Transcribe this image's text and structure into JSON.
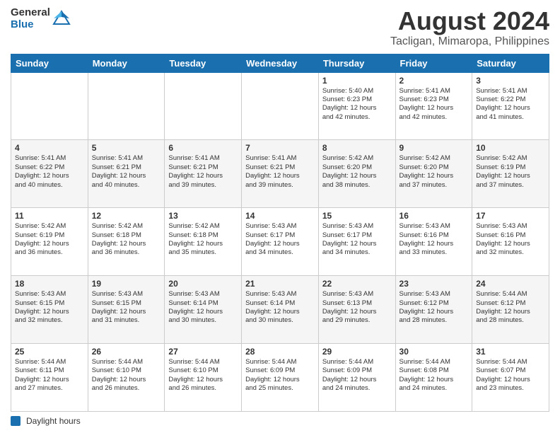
{
  "header": {
    "logo": {
      "line1": "General",
      "line2": "Blue"
    },
    "title": "August 2024",
    "subtitle": "Tacligan, Mimaropa, Philippines"
  },
  "days": [
    "Sunday",
    "Monday",
    "Tuesday",
    "Wednesday",
    "Thursday",
    "Friday",
    "Saturday"
  ],
  "weeks": [
    [
      {
        "day": "",
        "content": ""
      },
      {
        "day": "",
        "content": ""
      },
      {
        "day": "",
        "content": ""
      },
      {
        "day": "",
        "content": ""
      },
      {
        "day": "1",
        "content": "Sunrise: 5:40 AM\nSunset: 6:23 PM\nDaylight: 12 hours\nand 42 minutes."
      },
      {
        "day": "2",
        "content": "Sunrise: 5:41 AM\nSunset: 6:23 PM\nDaylight: 12 hours\nand 42 minutes."
      },
      {
        "day": "3",
        "content": "Sunrise: 5:41 AM\nSunset: 6:22 PM\nDaylight: 12 hours\nand 41 minutes."
      }
    ],
    [
      {
        "day": "4",
        "content": "Sunrise: 5:41 AM\nSunset: 6:22 PM\nDaylight: 12 hours\nand 40 minutes."
      },
      {
        "day": "5",
        "content": "Sunrise: 5:41 AM\nSunset: 6:21 PM\nDaylight: 12 hours\nand 40 minutes."
      },
      {
        "day": "6",
        "content": "Sunrise: 5:41 AM\nSunset: 6:21 PM\nDaylight: 12 hours\nand 39 minutes."
      },
      {
        "day": "7",
        "content": "Sunrise: 5:41 AM\nSunset: 6:21 PM\nDaylight: 12 hours\nand 39 minutes."
      },
      {
        "day": "8",
        "content": "Sunrise: 5:42 AM\nSunset: 6:20 PM\nDaylight: 12 hours\nand 38 minutes."
      },
      {
        "day": "9",
        "content": "Sunrise: 5:42 AM\nSunset: 6:20 PM\nDaylight: 12 hours\nand 37 minutes."
      },
      {
        "day": "10",
        "content": "Sunrise: 5:42 AM\nSunset: 6:19 PM\nDaylight: 12 hours\nand 37 minutes."
      }
    ],
    [
      {
        "day": "11",
        "content": "Sunrise: 5:42 AM\nSunset: 6:19 PM\nDaylight: 12 hours\nand 36 minutes."
      },
      {
        "day": "12",
        "content": "Sunrise: 5:42 AM\nSunset: 6:18 PM\nDaylight: 12 hours\nand 36 minutes."
      },
      {
        "day": "13",
        "content": "Sunrise: 5:42 AM\nSunset: 6:18 PM\nDaylight: 12 hours\nand 35 minutes."
      },
      {
        "day": "14",
        "content": "Sunrise: 5:43 AM\nSunset: 6:17 PM\nDaylight: 12 hours\nand 34 minutes."
      },
      {
        "day": "15",
        "content": "Sunrise: 5:43 AM\nSunset: 6:17 PM\nDaylight: 12 hours\nand 34 minutes."
      },
      {
        "day": "16",
        "content": "Sunrise: 5:43 AM\nSunset: 6:16 PM\nDaylight: 12 hours\nand 33 minutes."
      },
      {
        "day": "17",
        "content": "Sunrise: 5:43 AM\nSunset: 6:16 PM\nDaylight: 12 hours\nand 32 minutes."
      }
    ],
    [
      {
        "day": "18",
        "content": "Sunrise: 5:43 AM\nSunset: 6:15 PM\nDaylight: 12 hours\nand 32 minutes."
      },
      {
        "day": "19",
        "content": "Sunrise: 5:43 AM\nSunset: 6:15 PM\nDaylight: 12 hours\nand 31 minutes."
      },
      {
        "day": "20",
        "content": "Sunrise: 5:43 AM\nSunset: 6:14 PM\nDaylight: 12 hours\nand 30 minutes."
      },
      {
        "day": "21",
        "content": "Sunrise: 5:43 AM\nSunset: 6:14 PM\nDaylight: 12 hours\nand 30 minutes."
      },
      {
        "day": "22",
        "content": "Sunrise: 5:43 AM\nSunset: 6:13 PM\nDaylight: 12 hours\nand 29 minutes."
      },
      {
        "day": "23",
        "content": "Sunrise: 5:43 AM\nSunset: 6:12 PM\nDaylight: 12 hours\nand 28 minutes."
      },
      {
        "day": "24",
        "content": "Sunrise: 5:44 AM\nSunset: 6:12 PM\nDaylight: 12 hours\nand 28 minutes."
      }
    ],
    [
      {
        "day": "25",
        "content": "Sunrise: 5:44 AM\nSunset: 6:11 PM\nDaylight: 12 hours\nand 27 minutes."
      },
      {
        "day": "26",
        "content": "Sunrise: 5:44 AM\nSunset: 6:10 PM\nDaylight: 12 hours\nand 26 minutes."
      },
      {
        "day": "27",
        "content": "Sunrise: 5:44 AM\nSunset: 6:10 PM\nDaylight: 12 hours\nand 26 minutes."
      },
      {
        "day": "28",
        "content": "Sunrise: 5:44 AM\nSunset: 6:09 PM\nDaylight: 12 hours\nand 25 minutes."
      },
      {
        "day": "29",
        "content": "Sunrise: 5:44 AM\nSunset: 6:09 PM\nDaylight: 12 hours\nand 24 minutes."
      },
      {
        "day": "30",
        "content": "Sunrise: 5:44 AM\nSunset: 6:08 PM\nDaylight: 12 hours\nand 24 minutes."
      },
      {
        "day": "31",
        "content": "Sunrise: 5:44 AM\nSunset: 6:07 PM\nDaylight: 12 hours\nand 23 minutes."
      }
    ]
  ],
  "footer": {
    "daylight_label": "Daylight hours"
  }
}
